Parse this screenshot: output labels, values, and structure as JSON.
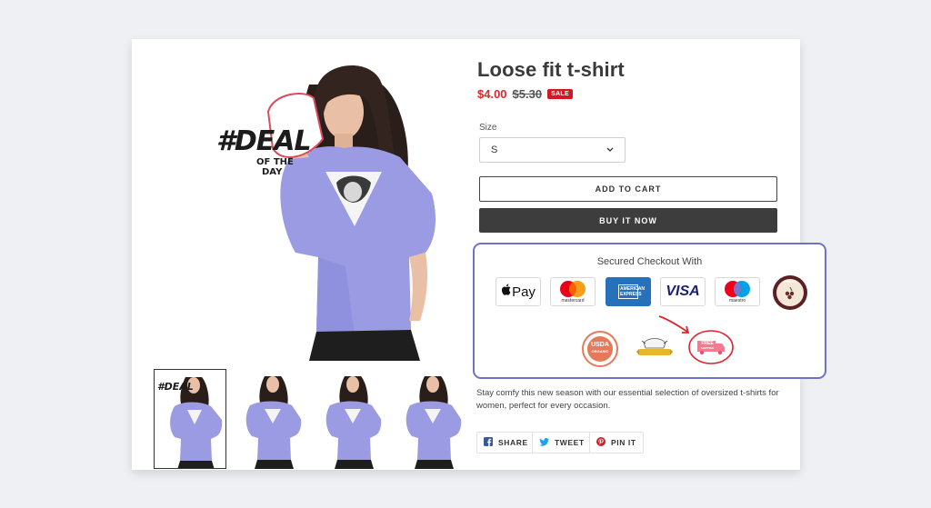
{
  "product": {
    "title": "Loose fit t-shirt",
    "price_sale": "$4.00",
    "price_original": "$5.30",
    "sale_badge": "SALE",
    "size_label": "Size",
    "size_value": "S",
    "add_to_cart": "ADD TO CART",
    "buy_now": "BUY IT NOW",
    "description": "Stay comfy this new season with our essential selection of oversized t-shirts for women, perfect for every occasion."
  },
  "promo": {
    "deal_line1": "#DEAL",
    "deal_line2": "OF THE",
    "deal_line3": "DAY"
  },
  "checkout": {
    "title": "Secured Checkout With",
    "applepay_label": "Pay",
    "mastercard_label": "mastercard",
    "amex_label": "AMERICAN EXPRESS",
    "visa_label": "VISA",
    "maestro_label": "maestro",
    "award_label": "AWARD",
    "usda_line1": "USDA",
    "usda_line2": "ORGANIC",
    "free_line1": "FREE",
    "free_line2": "SHIPPING"
  },
  "share": {
    "facebook": "SHARE",
    "twitter": "TWEET",
    "pinterest": "PIN IT"
  },
  "colors": {
    "accent_sale": "#e0242b",
    "shirt": "#9a9be3",
    "secured_border": "#6b73c9",
    "buy_button": "#3d3d3d"
  },
  "icons": [
    "chevron-down-icon",
    "apple-icon",
    "facebook-icon",
    "twitter-icon",
    "pinterest-icon",
    "arrow-icon"
  ]
}
